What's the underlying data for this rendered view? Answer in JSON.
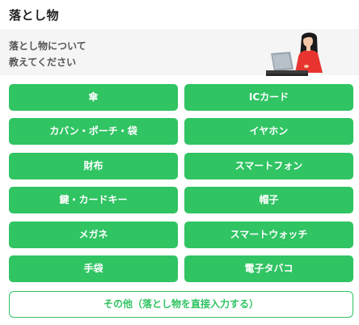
{
  "header": {
    "title": "落とし物"
  },
  "banner": {
    "prompt_line1": "落とし物について",
    "prompt_line2": "教えてください"
  },
  "options": [
    "傘",
    "ICカード",
    "カバン・ポーチ・袋",
    "イヤホン",
    "財布",
    "スマートフォン",
    "鍵・カードキー",
    "帽子",
    "メガネ",
    "スマートウォッチ",
    "手袋",
    "電子タバコ"
  ],
  "other_button": {
    "label": "その他（落とし物を直接入力する）"
  },
  "colors": {
    "accent": "#30c463",
    "banner_bg": "#f5f5f5"
  }
}
